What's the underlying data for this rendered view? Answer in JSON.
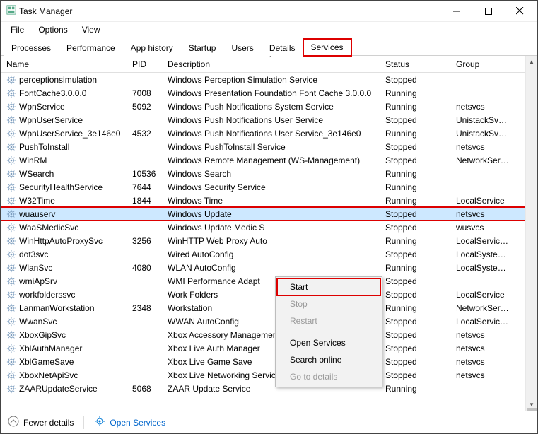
{
  "window": {
    "title": "Task Manager"
  },
  "menu": {
    "file": "File",
    "options": "Options",
    "view": "View"
  },
  "tabs": {
    "processes": "Processes",
    "performance": "Performance",
    "apphistory": "App history",
    "startup": "Startup",
    "users": "Users",
    "details": "Details",
    "services": "Services"
  },
  "columns": {
    "name": "Name",
    "pid": "PID",
    "desc": "Description",
    "status": "Status",
    "group": "Group"
  },
  "services": [
    {
      "name": "perceptionsimulation",
      "pid": "",
      "desc": "Windows Perception Simulation Service",
      "status": "Stopped",
      "group": ""
    },
    {
      "name": "FontCache3.0.0.0",
      "pid": "7008",
      "desc": "Windows Presentation Foundation Font Cache 3.0.0.0",
      "status": "Running",
      "group": ""
    },
    {
      "name": "WpnService",
      "pid": "5092",
      "desc": "Windows Push Notifications System Service",
      "status": "Running",
      "group": "netsvcs"
    },
    {
      "name": "WpnUserService",
      "pid": "",
      "desc": "Windows Push Notifications User Service",
      "status": "Stopped",
      "group": "UnistackSvcGr..."
    },
    {
      "name": "WpnUserService_3e146e0",
      "pid": "4532",
      "desc": "Windows Push Notifications User Service_3e146e0",
      "status": "Running",
      "group": "UnistackSvcGr..."
    },
    {
      "name": "PushToInstall",
      "pid": "",
      "desc": "Windows PushToInstall Service",
      "status": "Stopped",
      "group": "netsvcs"
    },
    {
      "name": "WinRM",
      "pid": "",
      "desc": "Windows Remote Management (WS-Management)",
      "status": "Stopped",
      "group": "NetworkService"
    },
    {
      "name": "WSearch",
      "pid": "10536",
      "desc": "Windows Search",
      "status": "Running",
      "group": ""
    },
    {
      "name": "SecurityHealthService",
      "pid": "7644",
      "desc": "Windows Security Service",
      "status": "Running",
      "group": ""
    },
    {
      "name": "W32Time",
      "pid": "1844",
      "desc": "Windows Time",
      "status": "Running",
      "group": "LocalService"
    },
    {
      "name": "wuauserv",
      "pid": "",
      "desc": "Windows Update",
      "status": "Stopped",
      "group": "netsvcs"
    },
    {
      "name": "WaaSMedicSvc",
      "pid": "",
      "desc": "Windows Update Medic S",
      "status": "Stopped",
      "group": "wusvcs"
    },
    {
      "name": "WinHttpAutoProxySvc",
      "pid": "3256",
      "desc": "WinHTTP Web Proxy Auto",
      "status": "Running",
      "group": "LocalServiceN..."
    },
    {
      "name": "dot3svc",
      "pid": "",
      "desc": "Wired AutoConfig",
      "status": "Stopped",
      "group": "LocalSystemN..."
    },
    {
      "name": "WlanSvc",
      "pid": "4080",
      "desc": "WLAN AutoConfig",
      "status": "Running",
      "group": "LocalSystemN..."
    },
    {
      "name": "wmiApSrv",
      "pid": "",
      "desc": "WMI Performance Adapt",
      "status": "Stopped",
      "group": ""
    },
    {
      "name": "workfolderssvc",
      "pid": "",
      "desc": "Work Folders",
      "status": "Stopped",
      "group": "LocalService"
    },
    {
      "name": "LanmanWorkstation",
      "pid": "2348",
      "desc": "Workstation",
      "status": "Running",
      "group": "NetworkService"
    },
    {
      "name": "WwanSvc",
      "pid": "",
      "desc": "WWAN AutoConfig",
      "status": "Stopped",
      "group": "LocalServiceN..."
    },
    {
      "name": "XboxGipSvc",
      "pid": "",
      "desc": "Xbox Accessory Management Service",
      "status": "Stopped",
      "group": "netsvcs"
    },
    {
      "name": "XblAuthManager",
      "pid": "",
      "desc": "Xbox Live Auth Manager",
      "status": "Stopped",
      "group": "netsvcs"
    },
    {
      "name": "XblGameSave",
      "pid": "",
      "desc": "Xbox Live Game Save",
      "status": "Stopped",
      "group": "netsvcs"
    },
    {
      "name": "XboxNetApiSvc",
      "pid": "",
      "desc": "Xbox Live Networking Service",
      "status": "Stopped",
      "group": "netsvcs"
    },
    {
      "name": "ZAARUpdateService",
      "pid": "5068",
      "desc": "ZAAR Update Service",
      "status": "Running",
      "group": ""
    }
  ],
  "selected_index": 10,
  "context_menu": {
    "start": "Start",
    "stop": "Stop",
    "restart": "Restart",
    "open_services": "Open Services",
    "search_online": "Search online",
    "go_to_details": "Go to details"
  },
  "statusbar": {
    "fewer": "Fewer details",
    "open_services": "Open Services"
  }
}
